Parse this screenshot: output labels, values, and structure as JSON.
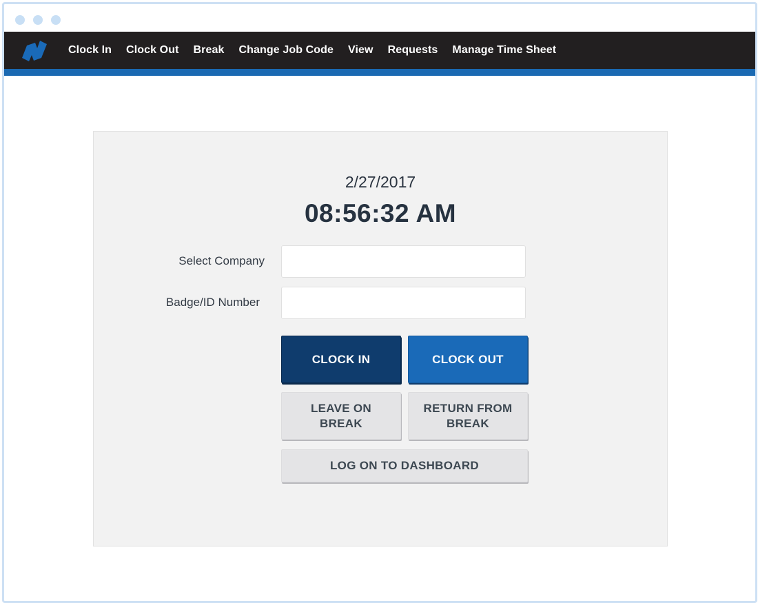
{
  "window": {
    "controls": [
      "dot",
      "dot",
      "dot"
    ]
  },
  "navbar": {
    "logo": "app-logo",
    "items": [
      {
        "label": "Clock In"
      },
      {
        "label": "Clock Out"
      },
      {
        "label": "Break"
      },
      {
        "label": "Change Job Code"
      },
      {
        "label": "View"
      },
      {
        "label": "Requests"
      },
      {
        "label": "Manage Time Sheet"
      }
    ]
  },
  "clock": {
    "date": "2/27/2017",
    "time": "08:56:32 AM"
  },
  "form": {
    "company_label": "Select Company",
    "company_value": "",
    "badge_label": "Badge/ID Number",
    "badge_value": ""
  },
  "buttons": {
    "clock_in": "CLOCK IN",
    "clock_out": "CLOCK OUT",
    "leave_break_line1": "LEAVE ON",
    "leave_break_line2": "BREAK",
    "return_break_line1": "RETURN FROM",
    "return_break_line2": "BREAK",
    "dashboard": "LOG ON TO DASHBOARD"
  },
  "colors": {
    "navbar_bg": "#221f20",
    "accent": "#1a69b2",
    "clock_in_bg": "#0f3c6d",
    "clock_out_bg": "#1a6ab8",
    "secondary_bg": "#e4e4e6"
  }
}
